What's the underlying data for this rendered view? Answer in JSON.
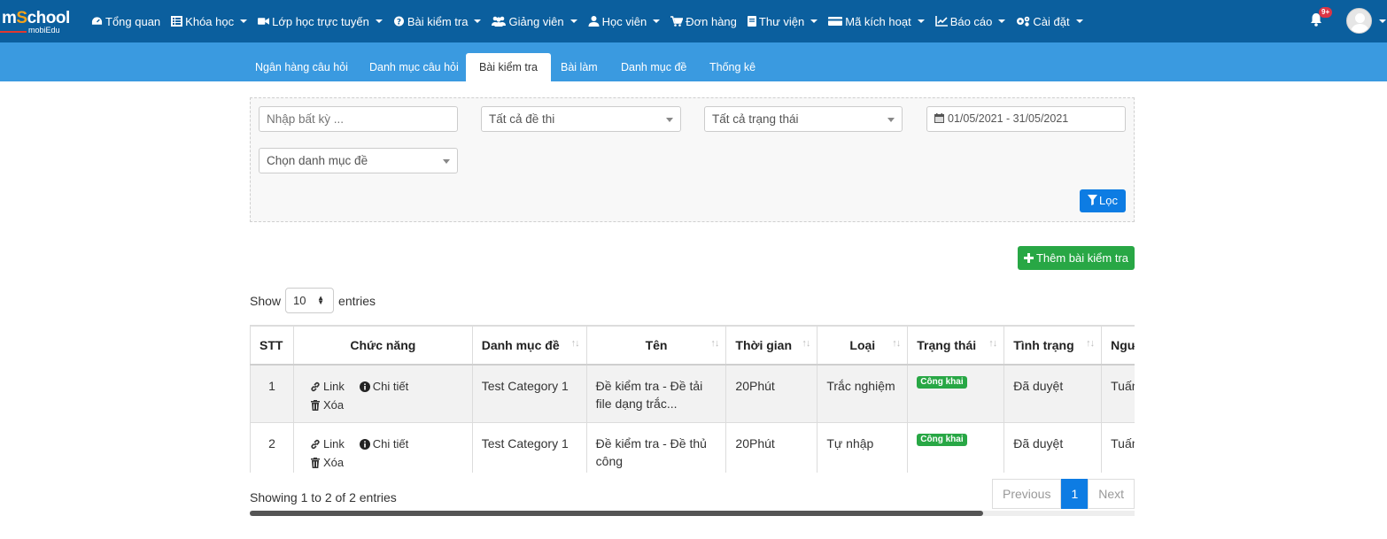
{
  "logo": {
    "part1": "m",
    "part_g": "S",
    "part2": "chool",
    "sub": "mobiEdu"
  },
  "topnav": {
    "items": [
      {
        "label": "Tổng quan",
        "icon": "dashboard-icon",
        "dropdown": false
      },
      {
        "label": "Khóa học",
        "icon": "list-icon",
        "dropdown": true
      },
      {
        "label": "Lớp học trực tuyến",
        "icon": "video-icon",
        "dropdown": true
      },
      {
        "label": "Bài kiểm tra",
        "icon": "question-circle-icon",
        "dropdown": true
      },
      {
        "label": "Giảng viên",
        "icon": "users-icon",
        "dropdown": true
      },
      {
        "label": "Học viên",
        "icon": "user-icon",
        "dropdown": true
      },
      {
        "label": "Đơn hàng",
        "icon": "cart-icon",
        "dropdown": false
      },
      {
        "label": "Thư viện",
        "icon": "book-icon",
        "dropdown": true
      },
      {
        "label": "Mã kích hoạt",
        "icon": "card-icon",
        "dropdown": true
      },
      {
        "label": "Báo cáo",
        "icon": "chart-icon",
        "dropdown": true
      },
      {
        "label": "Cài đặt",
        "icon": "gears-icon",
        "dropdown": true
      }
    ],
    "notification_count": "9+"
  },
  "subnav": {
    "tabs": [
      "Ngân hàng câu hỏi",
      "Danh mục câu hỏi",
      "Bài kiểm tra",
      "Bài làm",
      "Danh mục đề",
      "Thống kê"
    ],
    "active": "Bài kiểm tra"
  },
  "filters": {
    "search_placeholder": "Nhập bất kỳ ...",
    "exam_select": "Tất cả đề thi",
    "status_select": "Tất cả trạng thái",
    "date_range": "01/05/2021 - 31/05/2021",
    "category_select": "Chọn danh mục đề",
    "filter_button": "Lọc"
  },
  "add_button": "Thêm bài kiểm tra",
  "length": {
    "show": "Show",
    "value": "10",
    "entries": "entries"
  },
  "table": {
    "headers": [
      "STT",
      "Chức năng",
      "Danh mục đề",
      "Tên",
      "Thời gian",
      "Loại",
      "Trạng thái",
      "Tình trạng",
      "Ngư"
    ],
    "actions": {
      "link": "Link",
      "detail": "Chi tiết",
      "delete": "Xóa"
    },
    "rows": [
      {
        "stt": "1",
        "category": "Test Category 1",
        "name": "Đề kiểm tra - Đề tải file dạng trắc...",
        "time": "20Phút",
        "type": "Trắc nghiệm",
        "status": "Công khai",
        "state": "Đã duyệt",
        "person": "Tuấn"
      },
      {
        "stt": "2",
        "category": "Test Category 1",
        "name": "Đề kiểm tra - Đề thủ công",
        "time": "20Phút",
        "type": "Tự nhập",
        "status": "Công khai",
        "state": "Đã duyệt",
        "person": "Tuấn"
      }
    ]
  },
  "footer": {
    "info": "Showing 1 to 2 of 2 entries",
    "previous": "Previous",
    "page": "1",
    "next": "Next"
  },
  "colors": {
    "topnav": "#0b5f9e",
    "subnav": "#3a9ae0",
    "primary": "#0d7ce3",
    "success": "#28a745",
    "danger": "#dc3545"
  }
}
